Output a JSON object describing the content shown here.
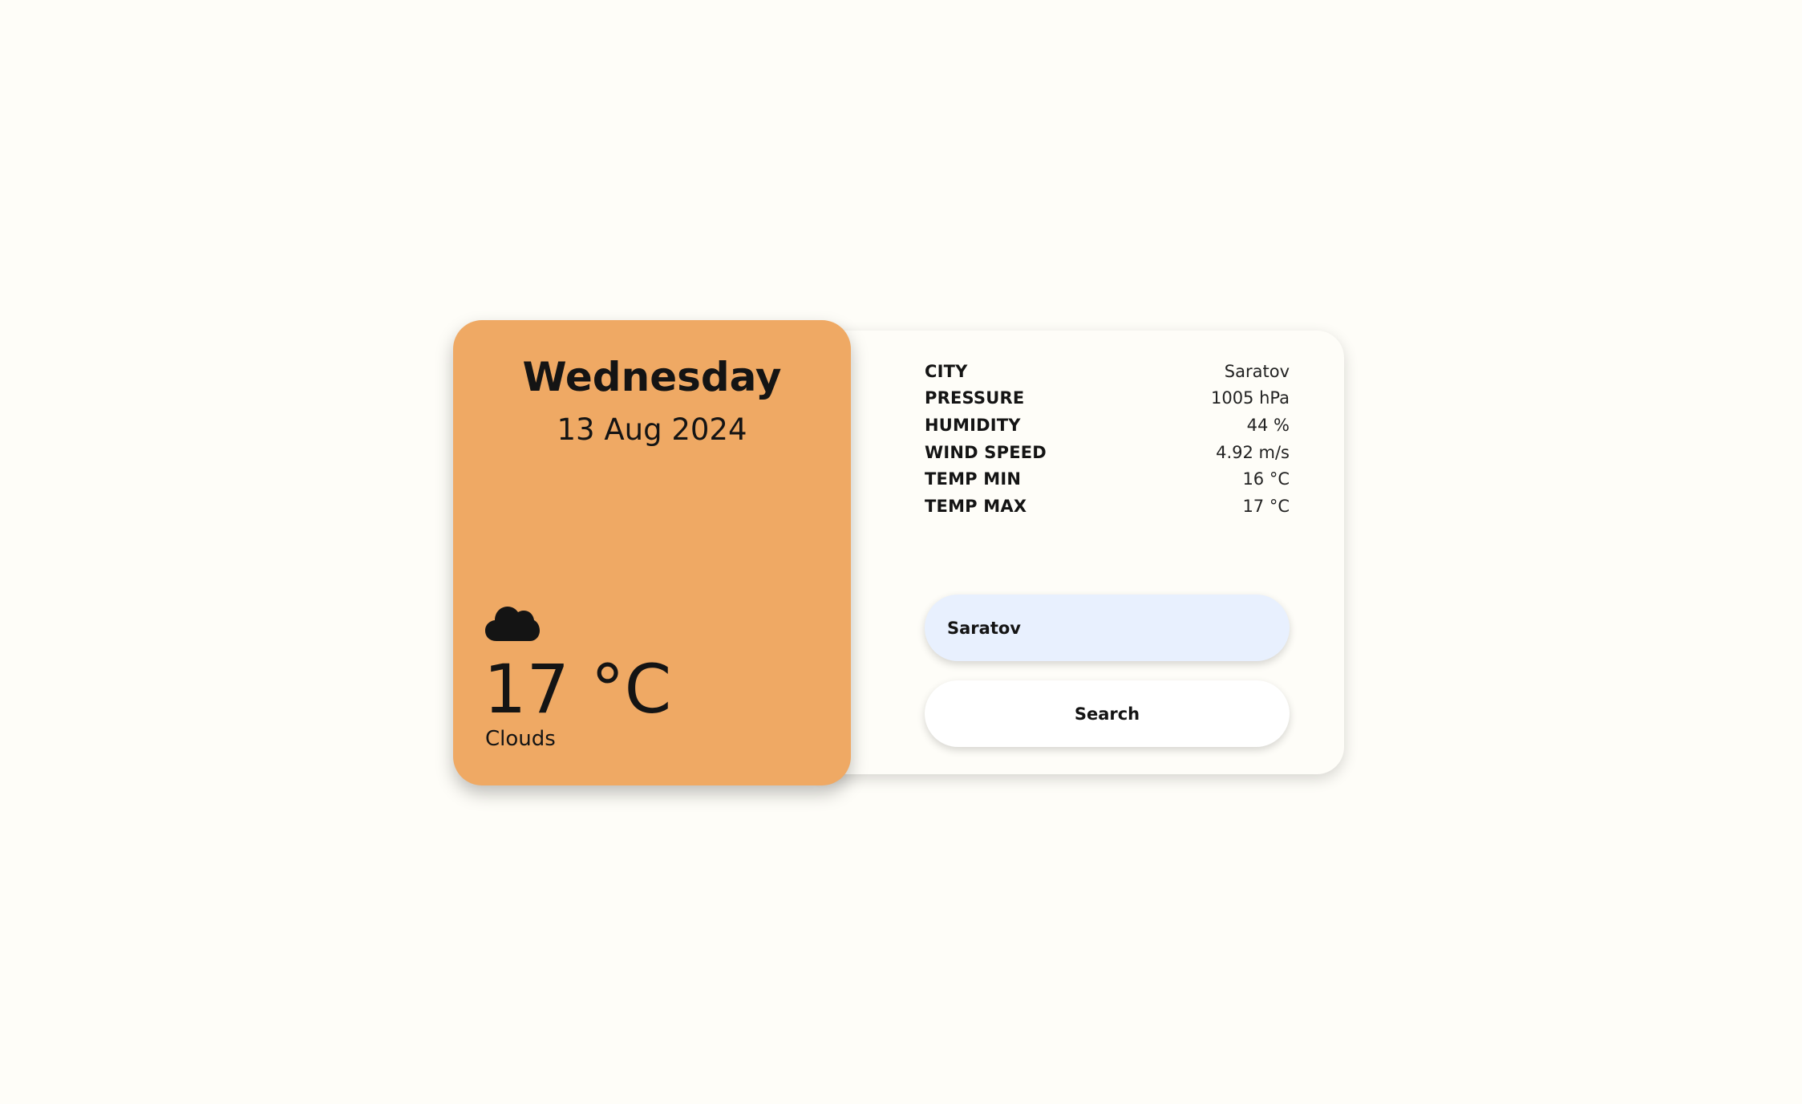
{
  "weather": {
    "weekday": "Wednesday",
    "date": "13 Aug 2024",
    "icon": "cloud-icon",
    "temperature": "17 °C",
    "condition": "Clouds"
  },
  "details": [
    {
      "label": "CITY",
      "value": "Saratov"
    },
    {
      "label": "PRESSURE",
      "value": "1005 hPa"
    },
    {
      "label": "HUMIDITY",
      "value": "44 %"
    },
    {
      "label": "WIND SPEED",
      "value": "4.92 m/s"
    },
    {
      "label": "TEMP MIN",
      "value": "16 °C"
    },
    {
      "label": "TEMP MAX",
      "value": "17 °C"
    }
  ],
  "search": {
    "value": "Saratov",
    "button_label": "Search"
  },
  "colors": {
    "background": "#FEFDF8",
    "card_accent": "#EFA964",
    "input_background": "#E8F0FE",
    "text": "#141414"
  }
}
